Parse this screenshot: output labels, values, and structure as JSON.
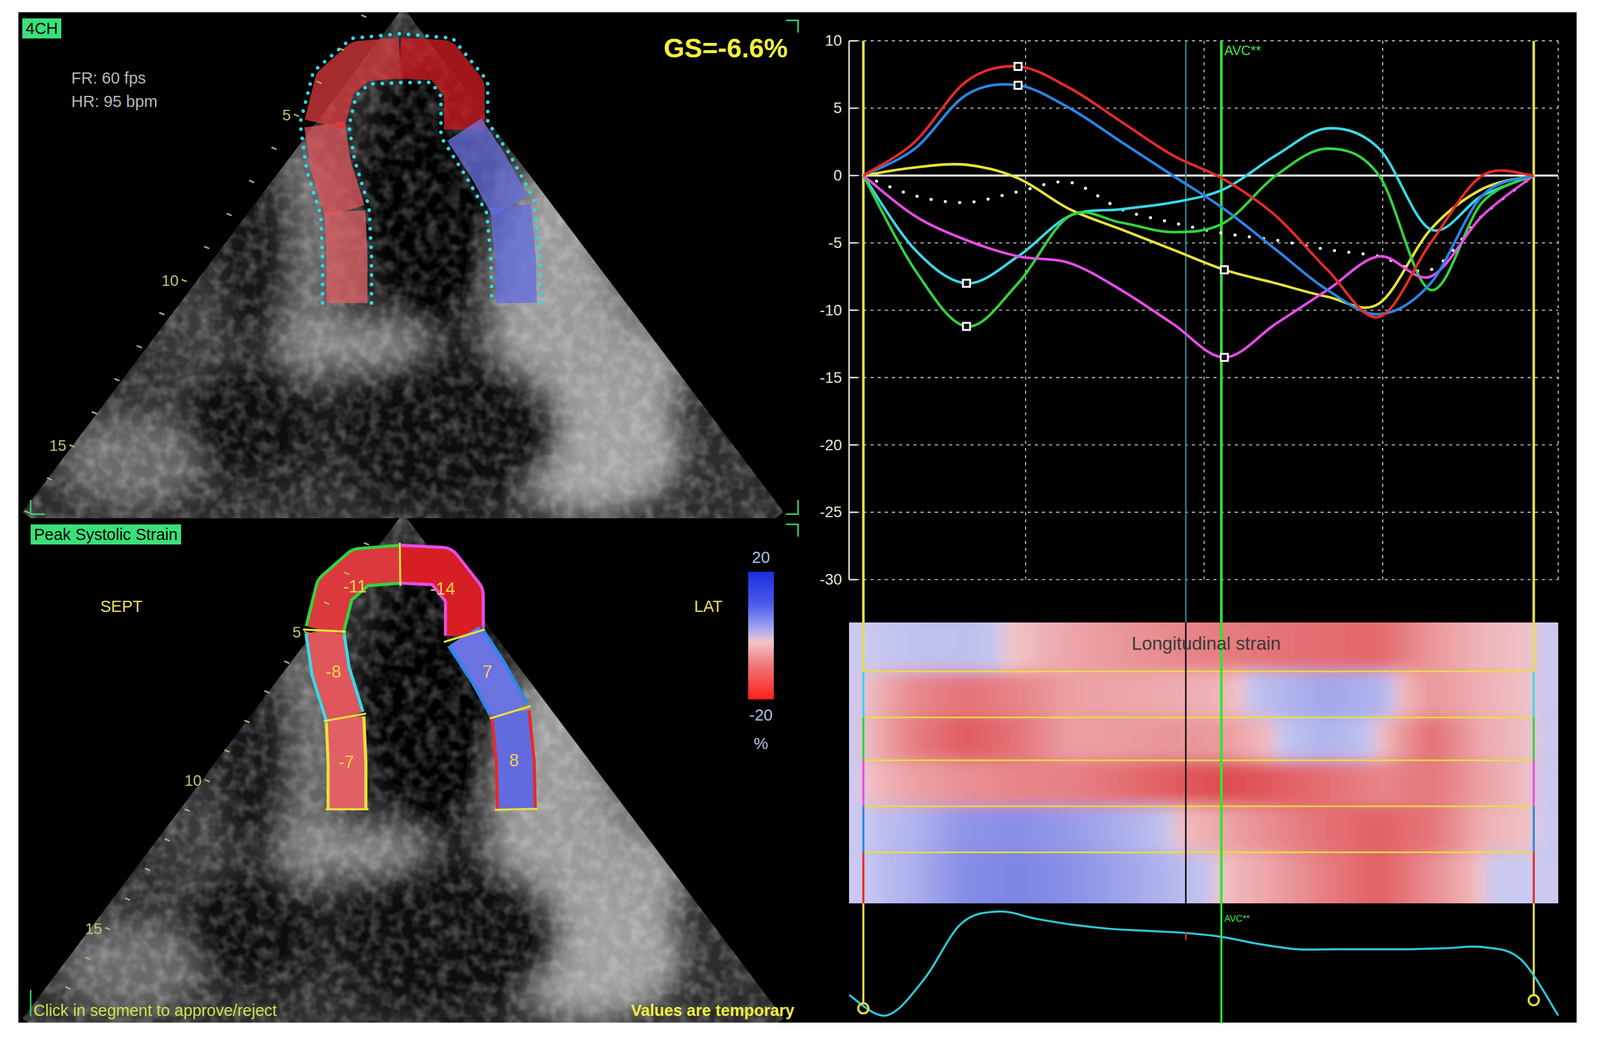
{
  "echo_view": {
    "view_label": "4CH",
    "frame_rate": "FR: 60 fps",
    "heart_rate": "HR: 95 bpm",
    "global_strain": "GS=-6.6%",
    "depth_ticks": [
      "5",
      "10",
      "15"
    ]
  },
  "segment_map": {
    "label": "Peak Systolic Strain",
    "septal_label": "SEPT",
    "lateral_label": "LAT",
    "depth_ticks": [
      "5",
      "10",
      "15"
    ],
    "segments": [
      {
        "value": "-7",
        "color": "#e8e23a"
      },
      {
        "value": "-8",
        "color": "#3ad8e8"
      },
      {
        "value": "-11",
        "color": "#32d43c"
      },
      {
        "value": "-14",
        "color": "#e84ce8"
      },
      {
        "value": "7",
        "color": "#2a86e8"
      },
      {
        "value": "8",
        "color": "#e82a2a"
      }
    ],
    "scale": {
      "max": "20",
      "min": "-20",
      "unit": "%"
    },
    "hint": "Click in segment to approve/reject",
    "notice": "Values are temporary"
  },
  "strain_chart": {
    "y_ticks": [
      "10",
      "5",
      "0",
      "-5",
      "-10",
      "-15",
      "-20",
      "-25",
      "-30"
    ],
    "marker_label": "AVC**",
    "marker_time": 0.534,
    "frame_time": 0.481,
    "series": [
      {
        "color": "#e8e23a",
        "peak_index": 7,
        "values": [
          0,
          0.6,
          0.8,
          -0.2,
          -2.5,
          -4,
          -5.5,
          -7,
          -8,
          -9,
          -9.5,
          -4,
          -1,
          0
        ]
      },
      {
        "color": "#3ad8e8",
        "peak_index": 2,
        "values": [
          0,
          -5.5,
          -8,
          -6,
          -3,
          -2.5,
          -2,
          -1,
          1.5,
          3.5,
          2,
          -4,
          -1.5,
          0
        ]
      },
      {
        "color": "#32d43c",
        "peak_index": 2,
        "values": [
          0,
          -7,
          -11.2,
          -8,
          -3,
          -3.5,
          -4.2,
          -3.5,
          0,
          2,
          0,
          -8.5,
          -2,
          0
        ]
      },
      {
        "color": "#e84ce8",
        "peak_index": 7,
        "values": [
          0,
          -3,
          -4.8,
          -6,
          -6.5,
          -8.5,
          -11,
          -13.5,
          -11,
          -8.5,
          -6,
          -7.5,
          -3,
          0
        ]
      },
      {
        "color": "#2a86e8",
        "peak_index": 3,
        "values": [
          0,
          2,
          6,
          6.7,
          5,
          2.5,
          0,
          -2.5,
          -5.5,
          -8.5,
          -10.3,
          -8,
          -1.5,
          0
        ]
      },
      {
        "color": "#e82a2a",
        "peak_index": 3,
        "values": [
          0,
          2.5,
          7,
          8.1,
          6.5,
          4,
          1.5,
          -0.3,
          -3,
          -7,
          -10.5,
          -5,
          0,
          0
        ]
      }
    ],
    "average": [
      0,
      -1.5,
      -2,
      -1.2,
      -0.5,
      -2.5,
      -3.5,
      -4.3,
      -4.8,
      -5.5,
      -6,
      -7,
      -3,
      0
    ]
  },
  "strain_map": {
    "title": "Longitudinal strain"
  },
  "ecg": {
    "marker_label": "AVC**",
    "values": [
      0.25,
      0.05,
      0.4,
      0.95,
      1.07,
      1.0,
      0.94,
      0.9,
      0.88,
      0.86,
      0.82,
      0.75,
      0.7,
      0.7,
      0.7,
      0.7,
      0.71,
      0.72,
      0.6,
      0.05
    ]
  }
}
